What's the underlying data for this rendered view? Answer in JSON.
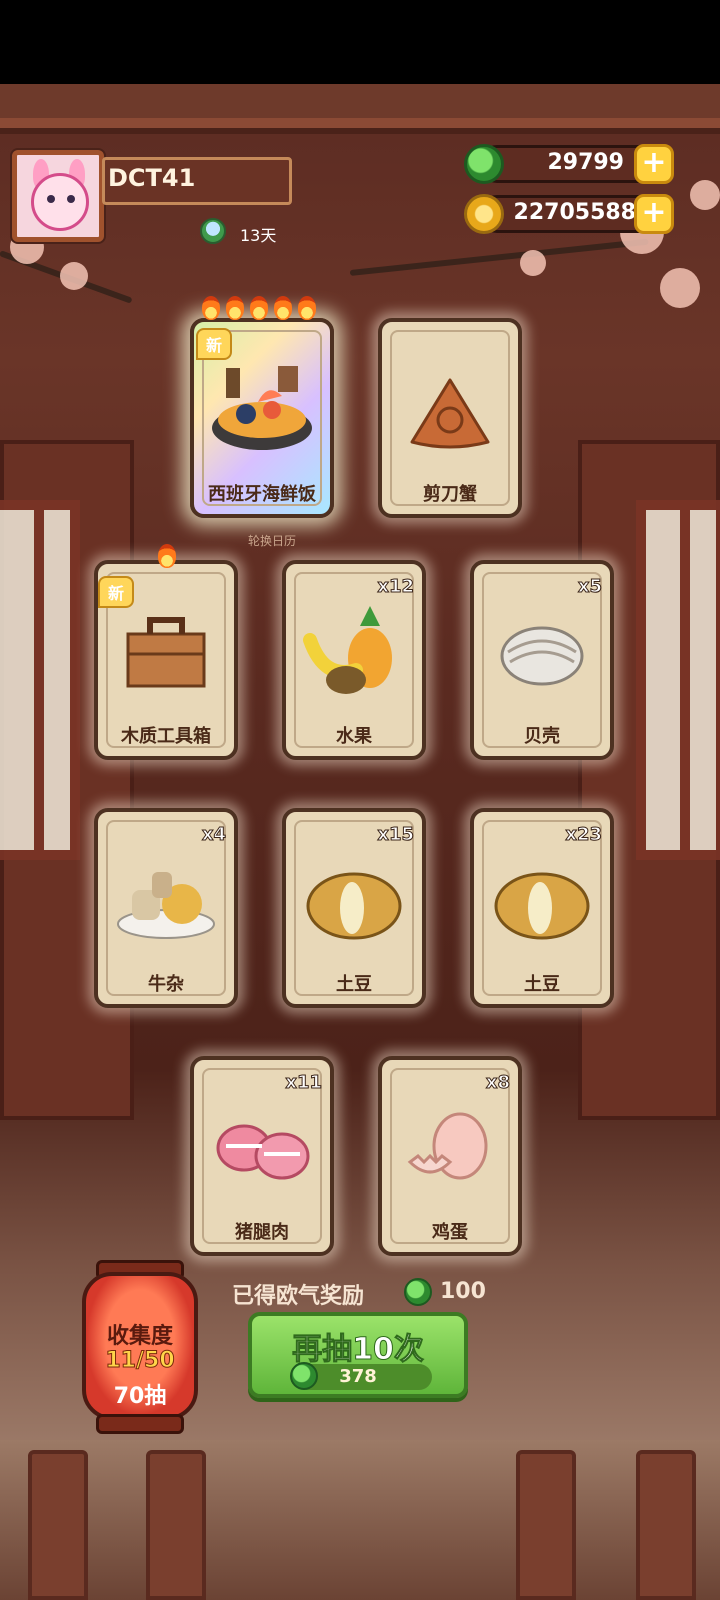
{
  "player": {
    "name": "DCT41",
    "days": "13天"
  },
  "currencies": [
    {
      "name": "jade",
      "value": "29799",
      "icon": "green-jade-coin-icon"
    },
    {
      "name": "gold",
      "value": "22705588",
      "icon": "gold-coin-icon"
    }
  ],
  "calendar_label": "轮换日历",
  "cards": [
    {
      "label": "西班牙海鲜饭",
      "count": "",
      "new": "新",
      "flames": 5
    },
    {
      "label": "剪刀蟹",
      "count": "",
      "new": "",
      "flames": 0
    },
    {
      "label": "木质工具箱",
      "count": "",
      "new": "新",
      "flames": 1
    },
    {
      "label": "水果",
      "count": "x12",
      "new": "",
      "flames": 0
    },
    {
      "label": "贝壳",
      "count": "x5",
      "new": "",
      "flames": 0
    },
    {
      "label": "牛杂",
      "count": "x4",
      "new": "",
      "flames": 0
    },
    {
      "label": "土豆",
      "count": "x15",
      "new": "",
      "flames": 0
    },
    {
      "label": "土豆",
      "count": "x23",
      "new": "",
      "flames": 0
    },
    {
      "label": "猪腿肉",
      "count": "x11",
      "new": "",
      "flames": 0
    },
    {
      "label": "鸡蛋",
      "count": "x8",
      "new": "",
      "flames": 0
    }
  ],
  "reward": {
    "text": "已得欧气奖励",
    "value": "100"
  },
  "draw_button": {
    "label": "再抽10次",
    "cost": "378"
  },
  "collection": {
    "title": "收集度",
    "progress": "11/50",
    "draws": "70抽"
  },
  "colors": {
    "draw_button": "#7ccb4c",
    "lantern": "#d6392b",
    "currency_plus": "#ffd23f"
  }
}
